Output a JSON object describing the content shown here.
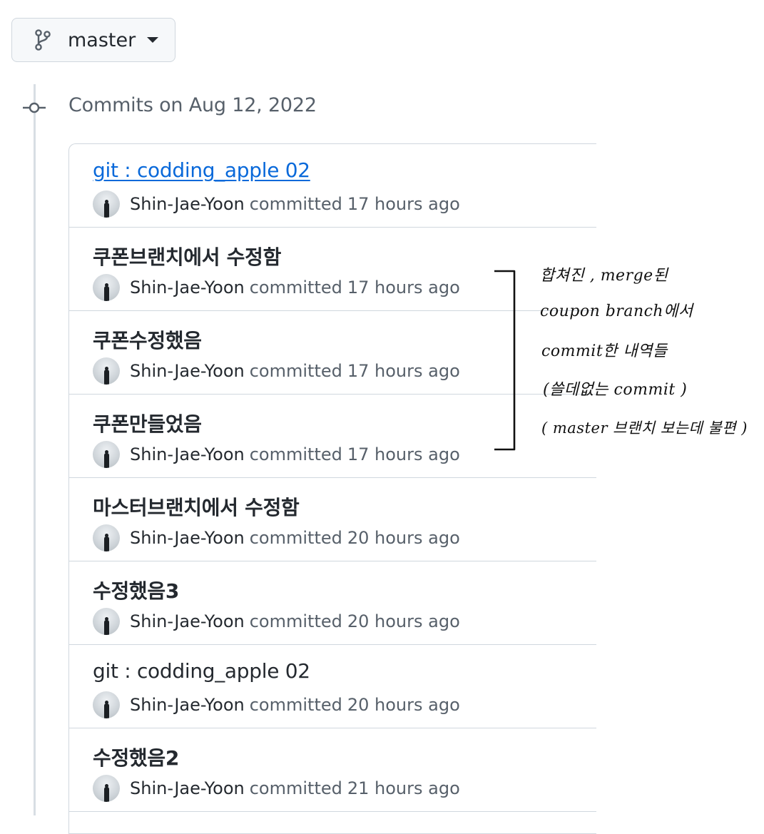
{
  "branch": {
    "label": "master",
    "icon": "git-branch-icon"
  },
  "timeline": {
    "date_header": "Commits on Aug 12, 2022",
    "icon": "git-commit-icon"
  },
  "commits": [
    {
      "title": "git : codding_apple 02",
      "author": "Shin-Jae-Yoon",
      "committed": "committed",
      "time": "17 hours ago"
    },
    {
      "title": "쿠폰브랜치에서 수정함",
      "author": "Shin-Jae-Yoon",
      "committed": "committed",
      "time": "17 hours ago"
    },
    {
      "title": "쿠폰수정했음",
      "author": "Shin-Jae-Yoon",
      "committed": "committed",
      "time": "17 hours ago"
    },
    {
      "title": "쿠폰만들었음",
      "author": "Shin-Jae-Yoon",
      "committed": "committed",
      "time": "17 hours ago"
    },
    {
      "title": "마스터브랜치에서 수정함",
      "author": "Shin-Jae-Yoon",
      "committed": "committed",
      "time": "20 hours ago"
    },
    {
      "title": "수정했음3",
      "author": "Shin-Jae-Yoon",
      "committed": "committed",
      "time": "20 hours ago"
    },
    {
      "title": "git : codding_apple 02",
      "author": "Shin-Jae-Yoon",
      "committed": "committed",
      "time": "20 hours ago"
    },
    {
      "title": "수정했음2",
      "author": "Shin-Jae-Yoon",
      "committed": "committed",
      "time": "21 hours ago"
    }
  ],
  "annotation": {
    "lines": [
      "합쳐진 , merge된",
      "coupon branch에서",
      "commit한  내역들",
      "(쓸데없는  commit )",
      "( master 브랜치 보는데 불편 )"
    ]
  }
}
